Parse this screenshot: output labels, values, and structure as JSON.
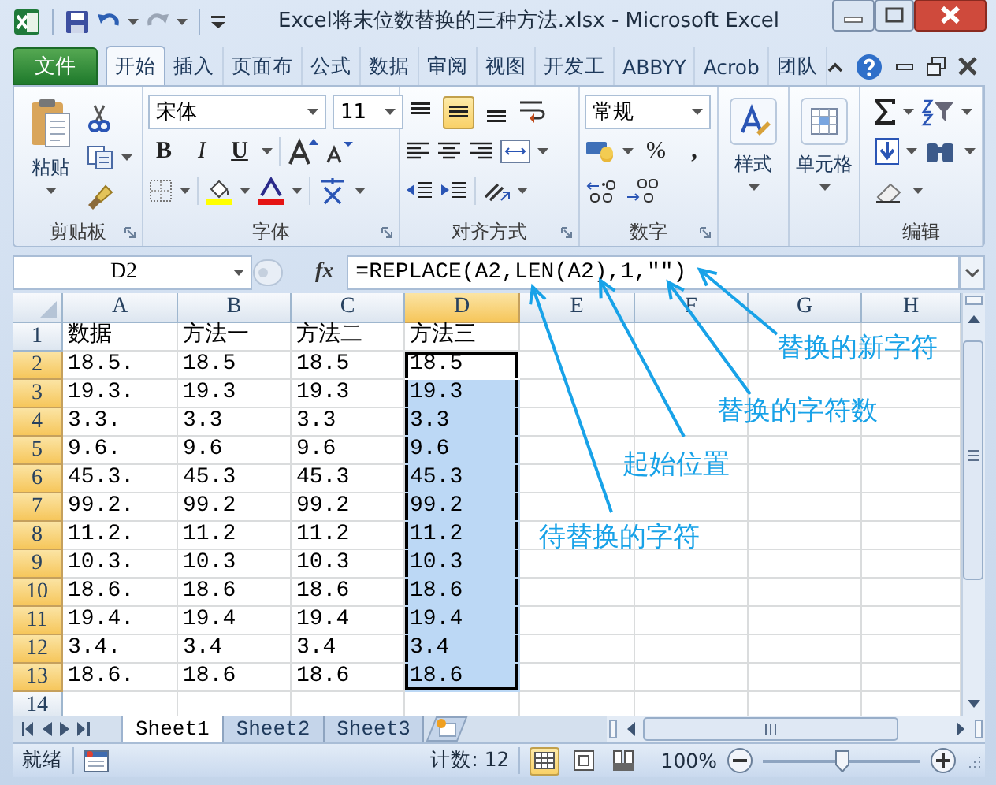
{
  "window": {
    "title": "Excel将末位数替换的三种方法.xlsx - Microsoft Excel"
  },
  "ribbon_tabs": [
    {
      "label": "文件",
      "kind": "file",
      "selected": false
    },
    {
      "label": "开始",
      "kind": "tab",
      "selected": true
    },
    {
      "label": "插入",
      "kind": "tab",
      "selected": false
    },
    {
      "label": "页面布",
      "kind": "tab",
      "selected": false
    },
    {
      "label": "公式",
      "kind": "tab",
      "selected": false
    },
    {
      "label": "数据",
      "kind": "tab",
      "selected": false
    },
    {
      "label": "审阅",
      "kind": "tab",
      "selected": false
    },
    {
      "label": "视图",
      "kind": "tab",
      "selected": false
    },
    {
      "label": "开发工",
      "kind": "tab",
      "selected": false
    },
    {
      "label": "ABBYY",
      "kind": "tab",
      "selected": false
    },
    {
      "label": "Acrob",
      "kind": "tab",
      "selected": false
    },
    {
      "label": "团队",
      "kind": "tab",
      "selected": false
    }
  ],
  "ribbon": {
    "clipboard": {
      "paste": "粘贴",
      "label": "剪贴板"
    },
    "font": {
      "name": "宋体",
      "size": "11",
      "bold": "B",
      "italic": "I",
      "underline": "U",
      "label": "字体"
    },
    "alignment": {
      "vertical": [
        {
          "kind": "top",
          "selected": false
        },
        {
          "kind": "middle",
          "selected": true
        },
        {
          "kind": "bottom",
          "selected": false
        }
      ],
      "label": "对齐方式"
    },
    "number": {
      "format": "常规",
      "percent": "%",
      "comma": ",",
      "label": "数字"
    },
    "styles": {
      "label": "样式"
    },
    "cells": {
      "label": "单元格"
    },
    "editing": {
      "label": "编辑"
    }
  },
  "formula_bar": {
    "name_box": "D2",
    "function_label": "fx",
    "formula": "=REPLACE(A2,LEN(A2),1,\"\")"
  },
  "sheet": {
    "columns": [
      {
        "label": "A",
        "selected": false
      },
      {
        "label": "B",
        "selected": false
      },
      {
        "label": "C",
        "selected": false
      },
      {
        "label": "D",
        "selected": true
      },
      {
        "label": "E",
        "selected": false
      },
      {
        "label": "F",
        "selected": false
      },
      {
        "label": "G",
        "selected": false
      },
      {
        "label": "H",
        "selected": false
      }
    ],
    "rows": [
      {
        "header": "1",
        "selected": false,
        "cells": [
          "数据",
          "方法一",
          "方法二",
          "方法三"
        ]
      },
      {
        "header": "2",
        "selected": true,
        "cells": [
          "18.5.",
          "18.5",
          "18.5",
          "18.5"
        ]
      },
      {
        "header": "3",
        "selected": true,
        "cells": [
          "19.3.",
          "19.3",
          "19.3",
          "19.3"
        ]
      },
      {
        "header": "4",
        "selected": true,
        "cells": [
          "3.3.",
          "3.3",
          "3.3",
          "3.3"
        ]
      },
      {
        "header": "5",
        "selected": true,
        "cells": [
          "9.6.",
          "9.6",
          "9.6",
          "9.6"
        ]
      },
      {
        "header": "6",
        "selected": true,
        "cells": [
          "45.3.",
          "45.3",
          "45.3",
          "45.3"
        ]
      },
      {
        "header": "7",
        "selected": true,
        "cells": [
          "99.2.",
          "99.2",
          "99.2",
          "99.2"
        ]
      },
      {
        "header": "8",
        "selected": true,
        "cells": [
          "11.2.",
          "11.2",
          "11.2",
          "11.2"
        ]
      },
      {
        "header": "9",
        "selected": true,
        "cells": [
          "10.3.",
          "10.3",
          "10.3",
          "10.3"
        ]
      },
      {
        "header": "10",
        "selected": true,
        "cells": [
          "18.6.",
          "18.6",
          "18.6",
          "18.6"
        ]
      },
      {
        "header": "11",
        "selected": true,
        "cells": [
          "19.4.",
          "19.4",
          "19.4",
          "19.4"
        ]
      },
      {
        "header": "12",
        "selected": true,
        "cells": [
          "3.4.",
          "3.4",
          "3.4",
          "3.4"
        ]
      },
      {
        "header": "13",
        "selected": true,
        "cells": [
          "18.6.",
          "18.6",
          "18.6",
          "18.6"
        ]
      },
      {
        "header": "14",
        "selected": false,
        "cells": []
      }
    ]
  },
  "sheet_tabs": [
    {
      "label": "Sheet1",
      "selected": true
    },
    {
      "label": "Sheet2",
      "selected": false
    },
    {
      "label": "Sheet3",
      "selected": false
    }
  ],
  "status_bar": {
    "status": "就绪",
    "count": "计数: 12",
    "views": [
      {
        "kind": "normal",
        "selected": true
      },
      {
        "kind": "page_layout",
        "selected": false
      },
      {
        "kind": "page_break",
        "selected": false
      }
    ],
    "zoom": {
      "reading": "100%",
      "level": 0.5
    }
  },
  "annotations": [
    {
      "text": "替换的新字符"
    },
    {
      "text": "替换的字符数"
    },
    {
      "text": "起始位置"
    },
    {
      "text": "待替换的字符"
    }
  ]
}
